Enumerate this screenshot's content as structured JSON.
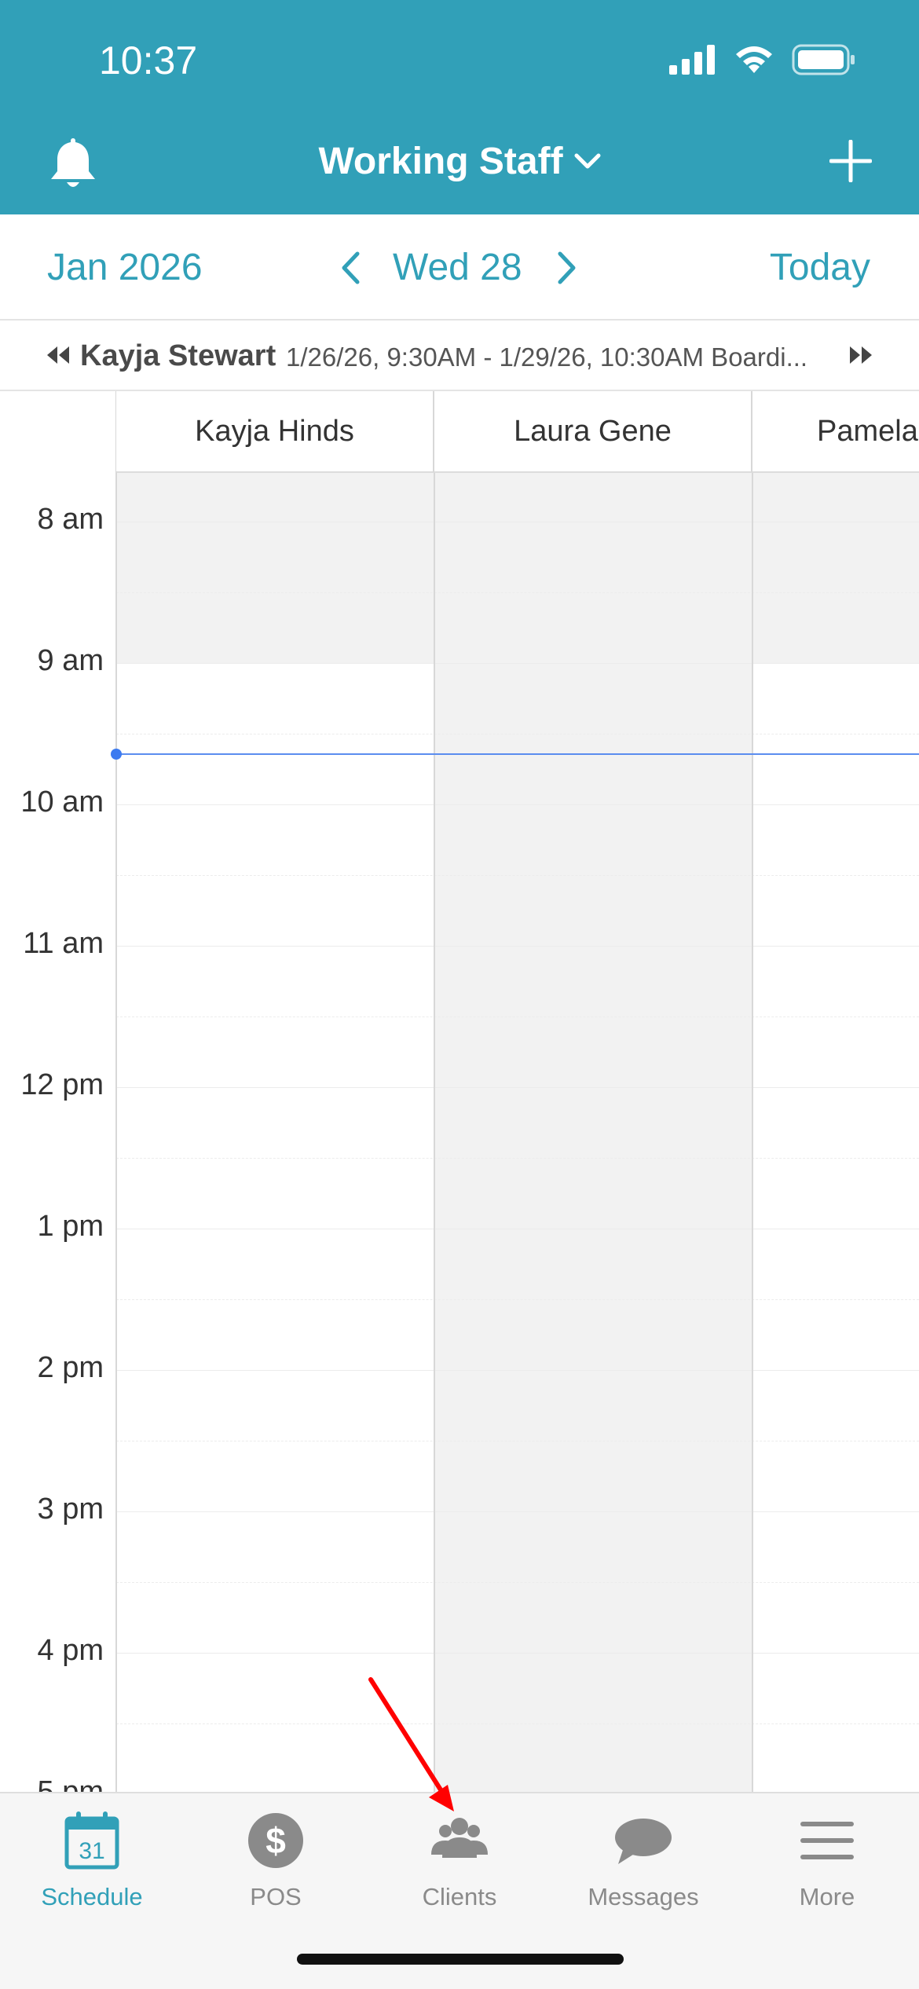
{
  "status_bar": {
    "time": "10:37"
  },
  "header": {
    "title": "Working Staff"
  },
  "datebar": {
    "month": "Jan 2026",
    "day": "Wed 28",
    "today": "Today"
  },
  "boarding": {
    "name": "Kayja Stewart",
    "detail": "1/26/26, 9:30AM - 1/29/26, 10:30AM Boardi..."
  },
  "columns": [
    "Kayja Hinds",
    "Laura Gene",
    "Pamela"
  ],
  "times": [
    "8 am",
    "9 am",
    "10 am",
    "11 am",
    "12 pm",
    "1 pm",
    "2 pm",
    "3 pm",
    "4 pm",
    "5 pm"
  ],
  "tabs": [
    {
      "label": "Schedule",
      "icon": "calendar-icon",
      "day": "31",
      "active": true
    },
    {
      "label": "POS",
      "icon": "dollar-icon",
      "symbol": "$",
      "active": false
    },
    {
      "label": "Clients",
      "icon": "clients-icon",
      "active": false
    },
    {
      "label": "Messages",
      "icon": "chat-bubble-icon",
      "active": false
    },
    {
      "label": "More",
      "icon": "menu-icon",
      "active": false
    }
  ],
  "colors": {
    "brand": "#31a0b8",
    "now_line": "#3d7bf0",
    "annotation_arrow": "#ff0000"
  }
}
